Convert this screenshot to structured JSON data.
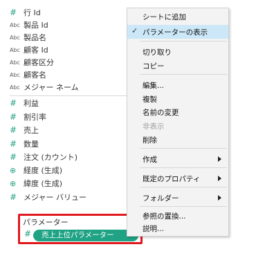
{
  "colors": {
    "accent": "#1fa384",
    "highlight_border": "#e0181e",
    "menu_hover": "#cce8f8"
  },
  "fields": [
    {
      "icon": "#",
      "label": "行 Id"
    },
    {
      "icon": "Abc",
      "label": "製品 Id"
    },
    {
      "icon": "Abc",
      "label": "製品名"
    },
    {
      "icon": "Abc",
      "label": "顧客 Id"
    },
    {
      "icon": "Abc",
      "label": "顧客区分"
    },
    {
      "icon": "Abc",
      "label": "顧客名"
    },
    {
      "icon": "Abc",
      "label": "メジャー ネーム"
    },
    {
      "icon": "#",
      "label": "利益"
    },
    {
      "icon": "#",
      "label": "割引率"
    },
    {
      "icon": "#",
      "label": "売上"
    },
    {
      "icon": "#",
      "label": "数量"
    },
    {
      "icon": "#",
      "label": "注文 (カウント)"
    },
    {
      "icon": "⊕",
      "label": "経度 (生成)"
    },
    {
      "icon": "⊕",
      "label": "緯度 (生成)"
    },
    {
      "icon": "#",
      "label": "メジャー バリュー"
    }
  ],
  "parameters": {
    "title": "パラメーター",
    "icon": "#",
    "items": [
      "売上上位パラメーター"
    ]
  },
  "context_menu": {
    "items": [
      {
        "label": "シートに追加"
      },
      {
        "label": "パラメーターの表示",
        "checked": true,
        "check": "✓"
      },
      {
        "label": "切り取り"
      },
      {
        "label": "コピー"
      },
      {
        "label": "編集..."
      },
      {
        "label": "複製"
      },
      {
        "label": "名前の変更"
      },
      {
        "label": "非表示",
        "disabled": true
      },
      {
        "label": "削除"
      },
      {
        "label": "作成",
        "submenu": true
      },
      {
        "label": "既定のプロパティ",
        "submenu": true
      },
      {
        "label": "フォルダー",
        "submenu": true
      },
      {
        "label": "参照の置換..."
      },
      {
        "label": "説明..."
      }
    ]
  }
}
